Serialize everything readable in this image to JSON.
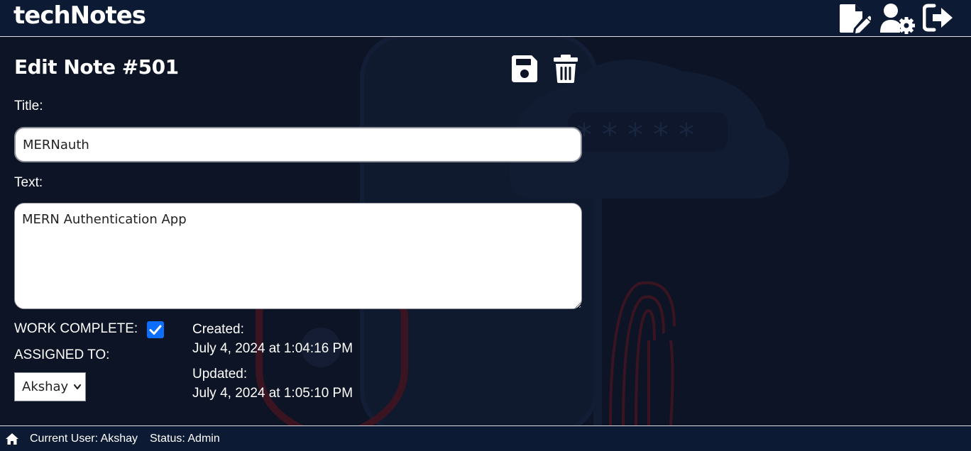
{
  "header": {
    "app_title": "techNotes"
  },
  "note": {
    "page_title": "Edit Note #501",
    "title_label": "Title:",
    "title_value": "MERNauth",
    "text_label": "Text:",
    "text_value": "MERN Authentication App",
    "work_complete_label": "WORK COMPLETE:",
    "work_complete_checked": true,
    "assigned_label": "ASSIGNED TO:",
    "assigned_user": "Akshay",
    "created_label": "Created:",
    "created_value": "July 4, 2024 at 1:04:16 PM",
    "updated_label": "Updated:",
    "updated_value": "July 4, 2024 at 1:05:10 PM"
  },
  "footer": {
    "current_user": "Current User: Akshay",
    "status": "Status: Admin"
  },
  "icons": {
    "new_note": "file-pen-icon",
    "users": "user-gear-icon",
    "logout": "logout-icon",
    "save": "floppy-disk-icon",
    "delete": "trash-icon",
    "home": "home-icon"
  },
  "colors": {
    "background": "#0c1425",
    "bar": "#0d1a33",
    "checkbox": "#0d6efd",
    "text": "#ffffff"
  }
}
